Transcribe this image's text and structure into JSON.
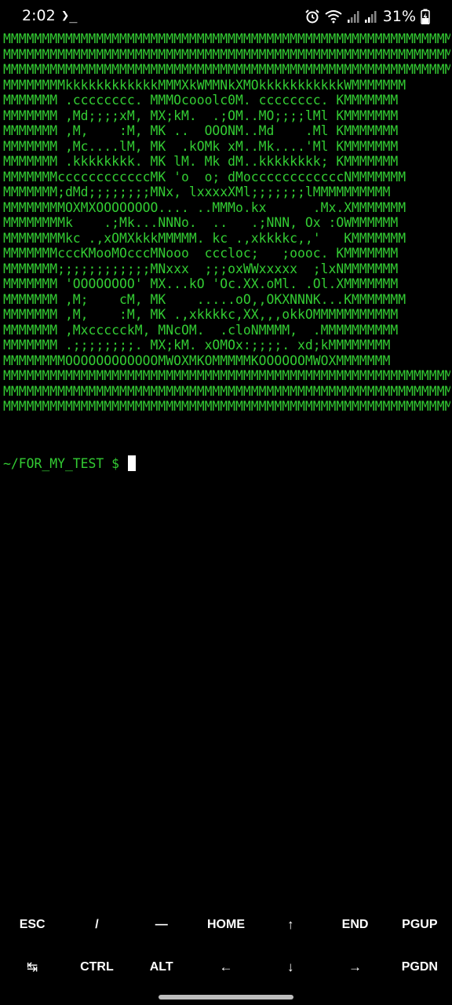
{
  "status": {
    "time": "2:02",
    "terminal_indicator": "❯_",
    "battery_percent": "31%",
    "icons": [
      "alarm-icon",
      "wifi-icon",
      "signal-icon",
      "signal-icon",
      "battery-charging-icon"
    ]
  },
  "terminal": {
    "lines": [
      "MMMMMMMMMMMMMMMMMMMMMMMMMMMMMMMMMMMMMMMMMMMMMMMMMMMMMMMMMMMM",
      "MMMMMMMMMMMMMMMMMMMMMMMMMMMMMMMMMMMMMMMMMMMMMMMMMMMMMMMMMMMM",
      "MMMMMMMMMMMMMMMMMMMMMMMMMMMMMMMMMMMMMMMMMMMMMMMMMMMMMMMMMMMM",
      "MMMMMMMMkkkkkkkkkkkkMMMXkWMMNkXMOkkkkkkkkkkkWMMMMMMM",
      "MMMMMMM .cccccccc. MMMOcooolc0M. cccccccc. KMMMMMMM",
      "MMMMMMM ,Md;;;;xM, MX;kM.  .;OM..MO;;;;lMl KMMMMMMM",
      "MMMMMMM ,M,    :M, MK ..  OOONM..Md    .Ml KMMMMMMM",
      "MMMMMMM ,Mc....lM, MK  .kOMk xM..Mk....'Ml KMMMMMMM",
      "MMMMMMM .kkkkkkkk. MK lM. Mk dM..kkkkkkkk; KMMMMMMM",
      "MMMMMMMccccccccccccMK 'o  o; dMoccccccccccccNMMMMMMM",
      "MMMMMMM;dMd;;;;;;;;MNx, lxxxxXMl;;;;;;;lMMMMMMMMMM",
      "MMMMMMMMOXMXOOOOOOOO.... ..MMMo.kx      .Mx.XMMMMMMM",
      "MMMMMMMMk    .;Mk...NNNo.  ..   .;NNN, Ox :OWMMMMMM",
      "MMMMMMMMkc .,xOMXkkkMMMMM. kc .,xkkkkc,,'   KMMMMMMM",
      "MMMMMMMcccKMooMOcccMNooo  cccloc;   ;oooc. KMMMMMMM",
      "MMMMMMM;;;;;;;;;;;;MNxxx  ;;;oxWWxxxxx  ;lxNMMMMMMM",
      "MMMMMMM 'OOOOOOOO' MX...kO 'Oc.XX.oMl. .Ol.XMMMMMMM",
      "MMMMMMM ,M;    cM, MK    .....oO,,OKXNNNK...KMMMMMMM",
      "MMMMMMM ,M,    :M, MK .,xkkkkc,XX,,,okkOMMMMMMMMMMM",
      "MMMMMMM ,MxccccckM, MNcOM.  .cloNMMMM,  .MMMMMMMMMM",
      "MMMMMMM .;;;;;;;;. MX;kM. xOMOx:;;;;. xd;kMMMMMMMM",
      "MMMMMMMMOOOOOOOOOOOOMWOXMKOMMMMMKOOOOOOMWOXMMMMMMM",
      "MMMMMMMMMMMMMMMMMMMMMMMMMMMMMMMMMMMMMMMMMMMMMMMMMMMMMMMMMMMM",
      "MMMMMMMMMMMMMMMMMMMMMMMMMMMMMMMMMMMMMMMMMMMMMMMMMMMMMMMMMMMM",
      "MMMMMMMMMMMMMMMMMMMMMMMMMMMMMMMMMMMMMMMMMMMMMMMMMMMMMMMMMMMM"
    ],
    "prompt": "~/FOR_MY_TEST $ ",
    "text_color": "#33cc33"
  },
  "extra_keys": {
    "row1": [
      "ESC",
      "/",
      "—",
      "HOME",
      "↑",
      "END",
      "PGUP"
    ],
    "row2": [
      "↹",
      "CTRL",
      "ALT",
      "←",
      "↓",
      "→",
      "PGDN"
    ]
  }
}
